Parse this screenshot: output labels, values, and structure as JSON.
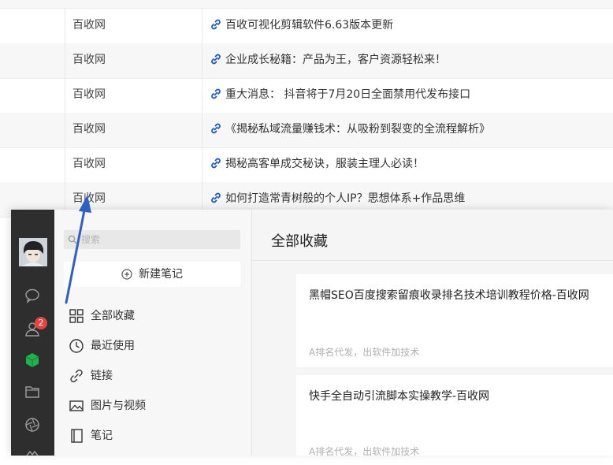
{
  "table": {
    "rows": [
      {
        "source": "百收网",
        "title": "百收可视化剪辑软件6.63版本更新"
      },
      {
        "source": "百收网",
        "title": "企业成长秘籍：产品为王，客户资源轻松来！"
      },
      {
        "source": "百收网",
        "title": "重大消息： 抖音将于7月20日全面禁用代发布接口"
      },
      {
        "source": "百收网",
        "title": "《揭秘私域流量赚钱术：从吸粉到裂变的全流程解析》"
      },
      {
        "source": "百收网",
        "title": "揭秘高客单成交秘诀，服装主理人必读！"
      },
      {
        "source": "百收网",
        "title": "如何打造常青树般的个人IP？思想体系+作品思维"
      }
    ],
    "link_icon": "link-icon"
  },
  "sidebar": {
    "badge_count": "2",
    "icons": [
      "chat-icon",
      "contacts-icon",
      "favorites-cube-icon",
      "folder-icon",
      "moments-aperture-icon",
      "mini-program-icon"
    ]
  },
  "favorites_panel": {
    "search_placeholder": "搜索",
    "new_note_label": "新建笔记",
    "nav": [
      {
        "icon": "grid-icon",
        "label": "全部收藏"
      },
      {
        "icon": "clock-icon",
        "label": "最近使用"
      },
      {
        "icon": "link-icon",
        "label": "链接"
      },
      {
        "icon": "image-icon",
        "label": "图片与视频"
      },
      {
        "icon": "notebook-icon",
        "label": "笔记"
      }
    ]
  },
  "main": {
    "title": "全部收藏",
    "cards": [
      {
        "title": "黑帽SEO百度搜索留痕收录排名技术培训教程价格-百收网",
        "subtitle": "A排名代发，出软件加技术"
      },
      {
        "title": "快手全自动引流脚本实操教学-百收网",
        "subtitle": "A排名代发，出软件加技术"
      }
    ]
  },
  "colors": {
    "rail": "#2e2e2e",
    "badge": "#e64340",
    "cube_active": "#20b24b",
    "link_icon": "#1e5bb8",
    "arrow": "#2f5ec4"
  }
}
